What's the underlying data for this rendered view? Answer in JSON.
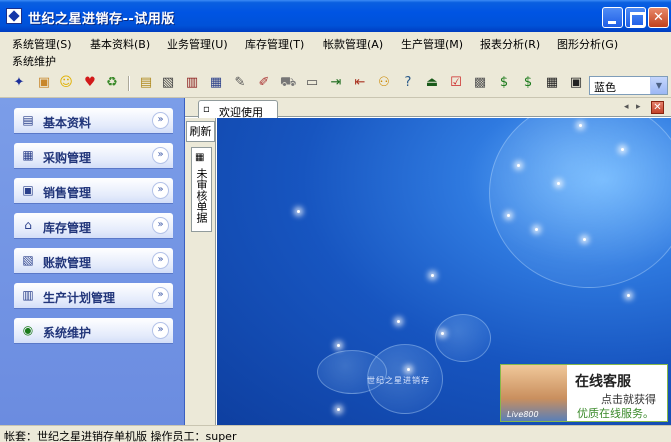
{
  "window": {
    "title": "世纪之星进销存--试用版",
    "close_glyph": "✕"
  },
  "menu": {
    "items": [
      {
        "label": "系统管理(S)"
      },
      {
        "label": "基本资料(B)"
      },
      {
        "label": "业务管理(U)"
      },
      {
        "label": "库存管理(T)"
      },
      {
        "label": "帐款管理(A)"
      },
      {
        "label": "生产管理(M)"
      },
      {
        "label": "报表分析(R)"
      },
      {
        "label": "图形分析(G)"
      },
      {
        "label": "系统维护"
      }
    ]
  },
  "toolbar": {
    "theme": {
      "selected": "蓝色",
      "arrow": "▼"
    }
  },
  "nav": {
    "chevron": "»",
    "groups": [
      {
        "label": "基本资料",
        "icon": "document-list-icon"
      },
      {
        "label": "采购管理",
        "icon": "purchase-icon"
      },
      {
        "label": "销售管理",
        "icon": "sales-icon"
      },
      {
        "label": "库存管理",
        "icon": "warehouse-icon"
      },
      {
        "label": "账款管理",
        "icon": "accounts-icon"
      },
      {
        "label": "生产计划管理",
        "icon": "production-icon"
      },
      {
        "label": "系统维护",
        "icon": "maintenance-icon"
      }
    ]
  },
  "tabs": {
    "welcome": "欢迎使用",
    "refresh": "刷新",
    "unreviewed": "未审核单据",
    "prev": "◂",
    "next": "▸",
    "close": "✕"
  },
  "splash": {
    "logo_text": "世纪之星进销存"
  },
  "service": {
    "title": "在线客服",
    "line1": "点击就获得",
    "line2": "优质在线服务。",
    "brand": "Live800"
  },
  "status": {
    "text": "帐套：世纪之星进销存单机版  操作员工：super"
  },
  "colors": {
    "titlebar": "#0054e3",
    "nav_bg": "#7b9de8",
    "splash_bg": "#1755c0",
    "service_accent": "#3a8a2a"
  }
}
